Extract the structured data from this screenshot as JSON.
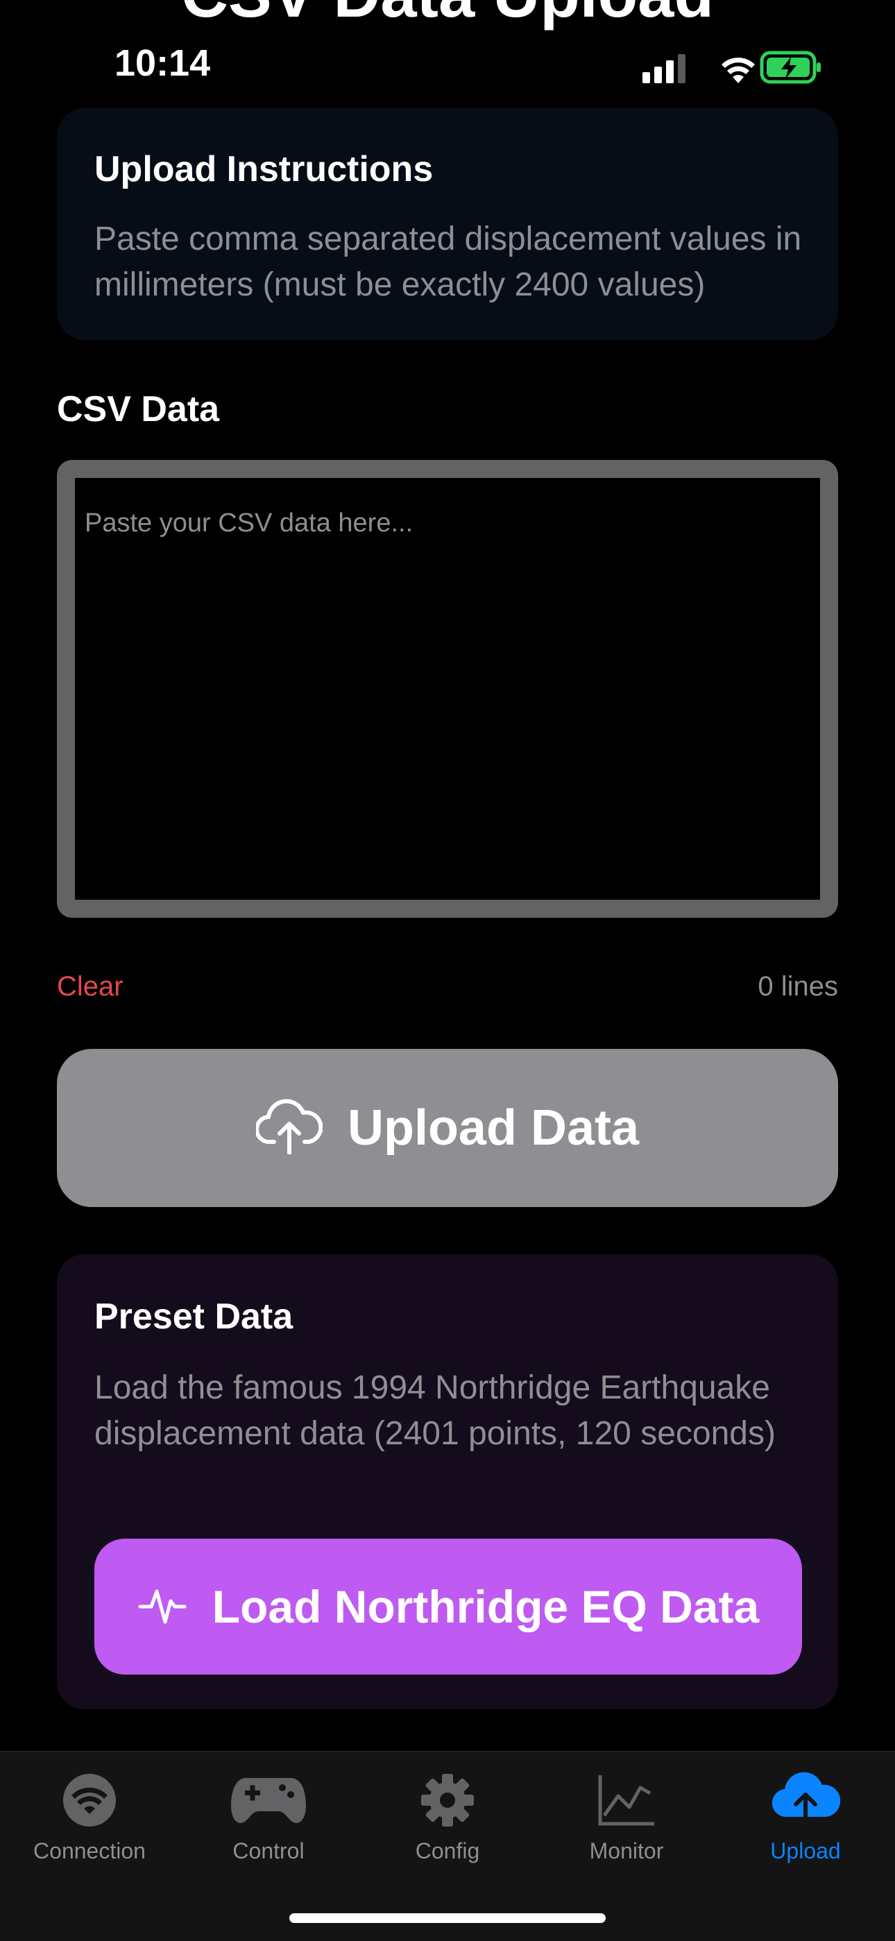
{
  "header": {
    "title": "CSV Data Upload"
  },
  "status_bar": {
    "time": "10:14"
  },
  "instructions": {
    "title": "Upload Instructions",
    "text": "Paste comma separated displacement values in millimeters (must be exactly 2400 values)"
  },
  "csv": {
    "label": "CSV Data",
    "placeholder": "Paste your CSV data here...",
    "value": "",
    "clear_label": "Clear",
    "line_count": "0 lines"
  },
  "upload_button": {
    "label": "Upload Data",
    "icon": "cloud-upload-icon"
  },
  "preset": {
    "title": "Preset Data",
    "text": "Load the famous 1994 Northridge Earthquake displacement data (2401 points, 120 seconds)",
    "button_label": "Load Northridge EQ Data",
    "button_icon": "waveform-icon"
  },
  "tabs": [
    {
      "label": "Connection",
      "icon": "wifi-icon",
      "active": false
    },
    {
      "label": "Control",
      "icon": "gamepad-icon",
      "active": false
    },
    {
      "label": "Config",
      "icon": "gear-icon",
      "active": false
    },
    {
      "label": "Monitor",
      "icon": "chart-icon",
      "active": false
    },
    {
      "label": "Upload",
      "icon": "cloud-upload-icon",
      "active": true
    }
  ],
  "colors": {
    "accent_blue": "#0a84ff",
    "preset_purple": "#bf5af2",
    "clear_red": "#e5484d",
    "disabled_gray": "#8e8e93"
  }
}
